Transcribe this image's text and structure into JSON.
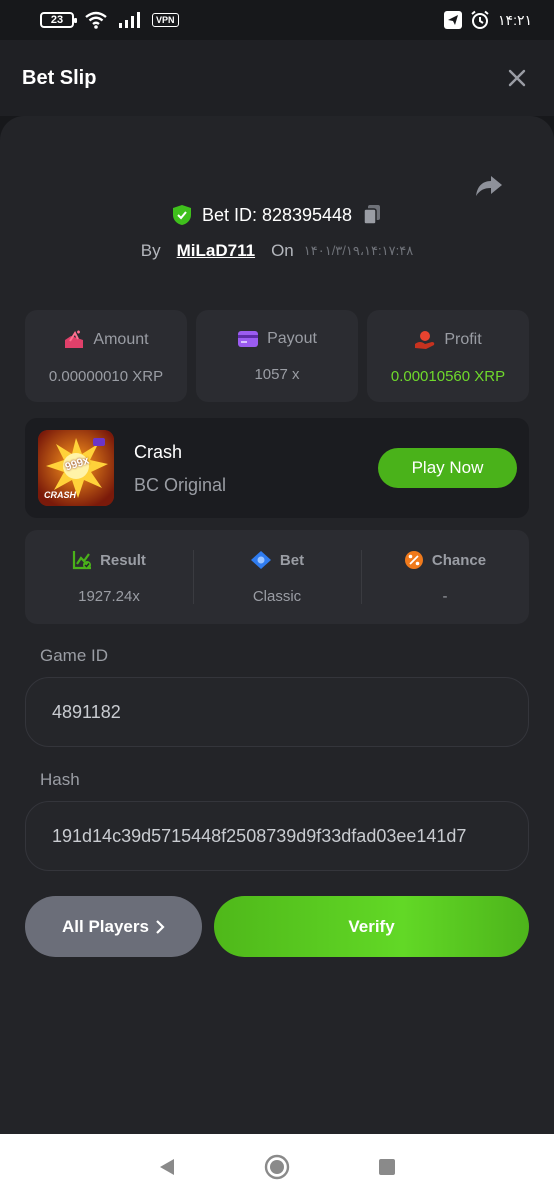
{
  "status_bar": {
    "battery": "23",
    "vpn": "VPN",
    "time": "۱۴:۲۱"
  },
  "header": {
    "title": "Bet Slip"
  },
  "bet": {
    "id_text": "Bet ID: 828395448",
    "by_label": "By",
    "user": "MiLaD711",
    "on_label": "On",
    "date": "۱۴۰۱/۳/۱۹،۱۴:۱۷:۴۸"
  },
  "stats": [
    {
      "label": "Amount",
      "value": "0.00000010 XRP"
    },
    {
      "label": "Payout",
      "value": "1057 x"
    },
    {
      "label": "Profit",
      "value": "0.00010560 XRP"
    }
  ],
  "game": {
    "name": "Crash",
    "provider": "BC Original",
    "thumb_badge": "999x",
    "thumb_text": "CRASH",
    "play_label": "Play Now"
  },
  "results": [
    {
      "label": "Result",
      "value": "1927.24x"
    },
    {
      "label": "Bet",
      "value": "Classic"
    },
    {
      "label": "Chance",
      "value": "-"
    }
  ],
  "fields": {
    "game_id_label": "Game ID",
    "game_id_value": "4891182",
    "hash_label": "Hash",
    "hash_value": "191d14c39d5715448f2508739d9f33dfad03ee141d7"
  },
  "actions": {
    "all_players": "All Players",
    "verify": "Verify"
  },
  "colors": {
    "accent_green": "#4ab21a",
    "profit_green": "#6fd92c",
    "background": "#17181b",
    "card": "#2b2c31"
  }
}
